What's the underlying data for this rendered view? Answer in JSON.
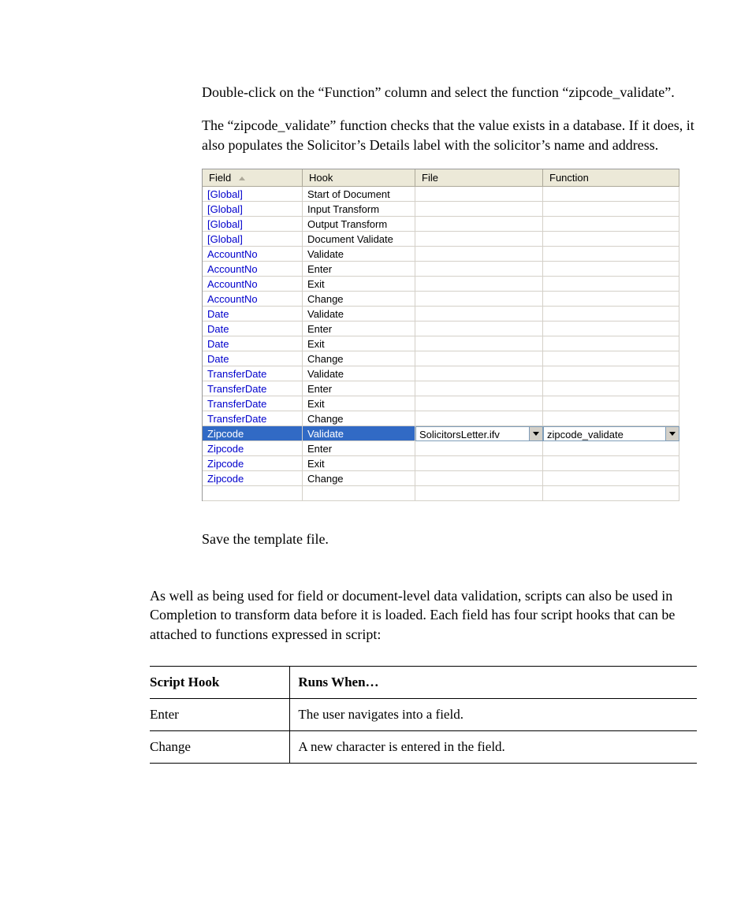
{
  "paragraphs": {
    "p1": "Double-click on the “Function” column and select the function “zipcode_validate”.",
    "p2": "The “zipcode_validate” function checks that the value exists in a database. If it does, it also populates the Solicitor’s Details label with the solicitor’s name and address.",
    "p3": "Save the template file.",
    "p4": "As well as being used for field or document-level data validation, scripts can also be used in Completion to transform data before it is loaded. Each field has four script hooks that can be attached to functions expressed in script:"
  },
  "grid": {
    "headers": {
      "field": "Field",
      "hook": "Hook",
      "file": "File",
      "func": "Function"
    },
    "rows": [
      {
        "field": "[Global]",
        "hook": "Start of Document",
        "file": "",
        "func": "",
        "selected": false
      },
      {
        "field": "[Global]",
        "hook": "Input Transform",
        "file": "",
        "func": "",
        "selected": false
      },
      {
        "field": "[Global]",
        "hook": "Output Transform",
        "file": "",
        "func": "",
        "selected": false
      },
      {
        "field": "[Global]",
        "hook": "Document Validate",
        "file": "",
        "func": "",
        "selected": false
      },
      {
        "field": "AccountNo",
        "hook": "Validate",
        "file": "",
        "func": "",
        "selected": false
      },
      {
        "field": "AccountNo",
        "hook": "Enter",
        "file": "",
        "func": "",
        "selected": false
      },
      {
        "field": "AccountNo",
        "hook": "Exit",
        "file": "",
        "func": "",
        "selected": false
      },
      {
        "field": "AccountNo",
        "hook": "Change",
        "file": "",
        "func": "",
        "selected": false
      },
      {
        "field": "Date",
        "hook": "Validate",
        "file": "",
        "func": "",
        "selected": false
      },
      {
        "field": "Date",
        "hook": "Enter",
        "file": "",
        "func": "",
        "selected": false
      },
      {
        "field": "Date",
        "hook": "Exit",
        "file": "",
        "func": "",
        "selected": false
      },
      {
        "field": "Date",
        "hook": "Change",
        "file": "",
        "func": "",
        "selected": false
      },
      {
        "field": "TransferDate",
        "hook": "Validate",
        "file": "",
        "func": "",
        "selected": false
      },
      {
        "field": "TransferDate",
        "hook": "Enter",
        "file": "",
        "func": "",
        "selected": false
      },
      {
        "field": "TransferDate",
        "hook": "Exit",
        "file": "",
        "func": "",
        "selected": false
      },
      {
        "field": "TransferDate",
        "hook": "Change",
        "file": "",
        "func": "",
        "selected": false
      },
      {
        "field": "Zipcode",
        "hook": "Validate",
        "file": "SolicitorsLetter.ifv",
        "func": "zipcode_validate",
        "selected": true
      },
      {
        "field": "Zipcode",
        "hook": "Enter",
        "file": "",
        "func": "",
        "selected": false
      },
      {
        "field": "Zipcode",
        "hook": "Exit",
        "file": "",
        "func": "",
        "selected": false
      },
      {
        "field": "Zipcode",
        "hook": "Change",
        "file": "",
        "func": "",
        "selected": false
      }
    ]
  },
  "hooks_table": {
    "header": {
      "col1": "Script Hook",
      "col2": "Runs When…"
    },
    "rows": [
      {
        "hook": "Enter",
        "when": "The user navigates into a field."
      },
      {
        "hook": "Change",
        "when": "A new character is entered in the field."
      }
    ]
  }
}
